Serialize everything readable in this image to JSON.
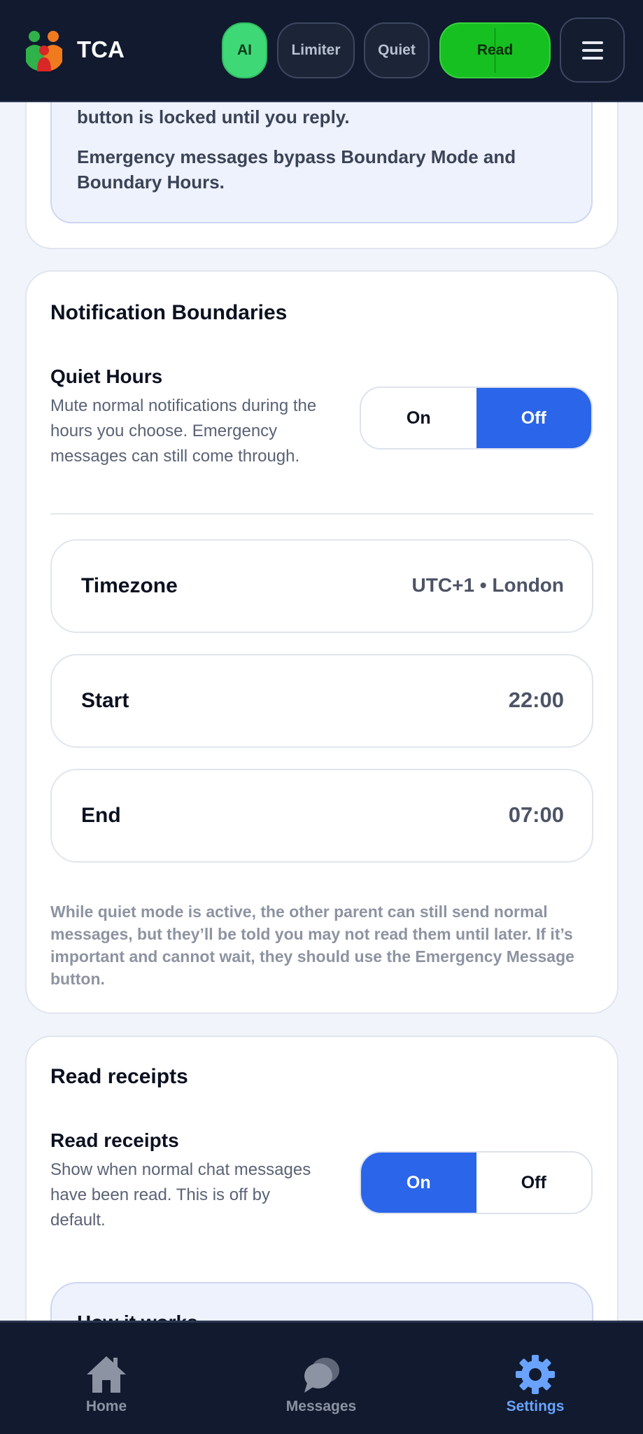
{
  "app": {
    "title": "TCA"
  },
  "header": {
    "pills": {
      "ai": "AI",
      "limiter": "Limiter",
      "quiet": "Quiet",
      "read": "Read"
    },
    "menu_icon": "hamburger-icon"
  },
  "emergency_info": {
    "line1": "button is locked until you reply.",
    "line2": "Emergency messages bypass Boundary Mode and Boundary Hours."
  },
  "notification_boundaries": {
    "title": "Notification Boundaries",
    "quiet_hours": {
      "title": "Quiet Hours",
      "description": "Mute normal notifications during the hours you choose. Emergency messages can still come through.",
      "toggle": {
        "on": "On",
        "off": "Off",
        "selected": "Off"
      }
    },
    "timezone": {
      "label": "Timezone",
      "value": "UTC+1 • London"
    },
    "start": {
      "label": "Start",
      "value": "22:00"
    },
    "end": {
      "label": "End",
      "value": "07:00"
    },
    "note": "While quiet mode is active, the other parent can still send normal messages, but they’ll be told you may not read them until later. If it’s important and cannot wait, they should use the Emergency Message button."
  },
  "read_receipts": {
    "title": "Read receipts",
    "setting_title": "Read receipts",
    "description": "Show when normal chat messages have been read. This is off by default.",
    "toggle": {
      "on": "On",
      "off": "Off",
      "selected": "On"
    },
    "how_it_works": "How it works"
  },
  "bottom_nav": {
    "items": [
      {
        "label": "Home",
        "icon": "home-icon"
      },
      {
        "label": "Messages",
        "icon": "messages-icon"
      },
      {
        "label": "Settings",
        "icon": "settings-icon",
        "active": true
      }
    ]
  },
  "colors": {
    "accent": "#2a65ea",
    "header_bg": "#111a2e",
    "ai_pill": "#3fd877",
    "read_pill": "#16c020",
    "active_nav": "#69a3ff"
  }
}
